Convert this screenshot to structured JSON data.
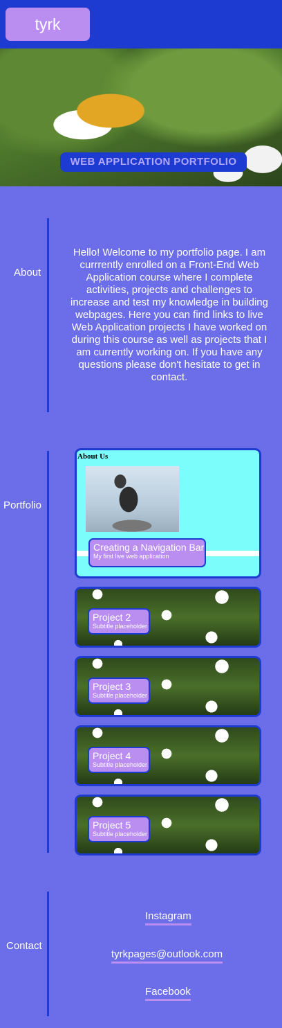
{
  "header": {
    "logo": "tyrk"
  },
  "hero": {
    "title": "WEB APPLICATION PORTFOLIO"
  },
  "about": {
    "label": "About",
    "text": "Hello! Welcome to my portfolio page. I am currrently enrolled on a Front-End Web Application course where I complete activities, projects and challenges to increase and test my knowledge in building webpages. Here you can find links to live Web Application projects I have worked on during this course as well as projects that I am currently working on. If you have any questions please don't hesitate to get in contact."
  },
  "portfolio": {
    "label": "Portfolio",
    "projects": [
      {
        "title": "Creating a Navigation Bar",
        "subtitle": "My first live web application",
        "preview_heading": "About Us"
      },
      {
        "title": "Project 2",
        "subtitle": "Subtitle placeholder"
      },
      {
        "title": "Project 3",
        "subtitle": "Subtitle placeholder"
      },
      {
        "title": "Project 4",
        "subtitle": "Subtitle placeholder"
      },
      {
        "title": "Project 5",
        "subtitle": "Subtitle placeholder"
      }
    ]
  },
  "contact": {
    "label": "Contact",
    "links": [
      "Instagram",
      "tyrkpages@outlook.com",
      "Facebook"
    ]
  },
  "colors": {
    "header": "#1e3bd1",
    "page": "#6b6ee8",
    "accent": "#b98ef0",
    "card1_bg": "#7afdfb"
  }
}
